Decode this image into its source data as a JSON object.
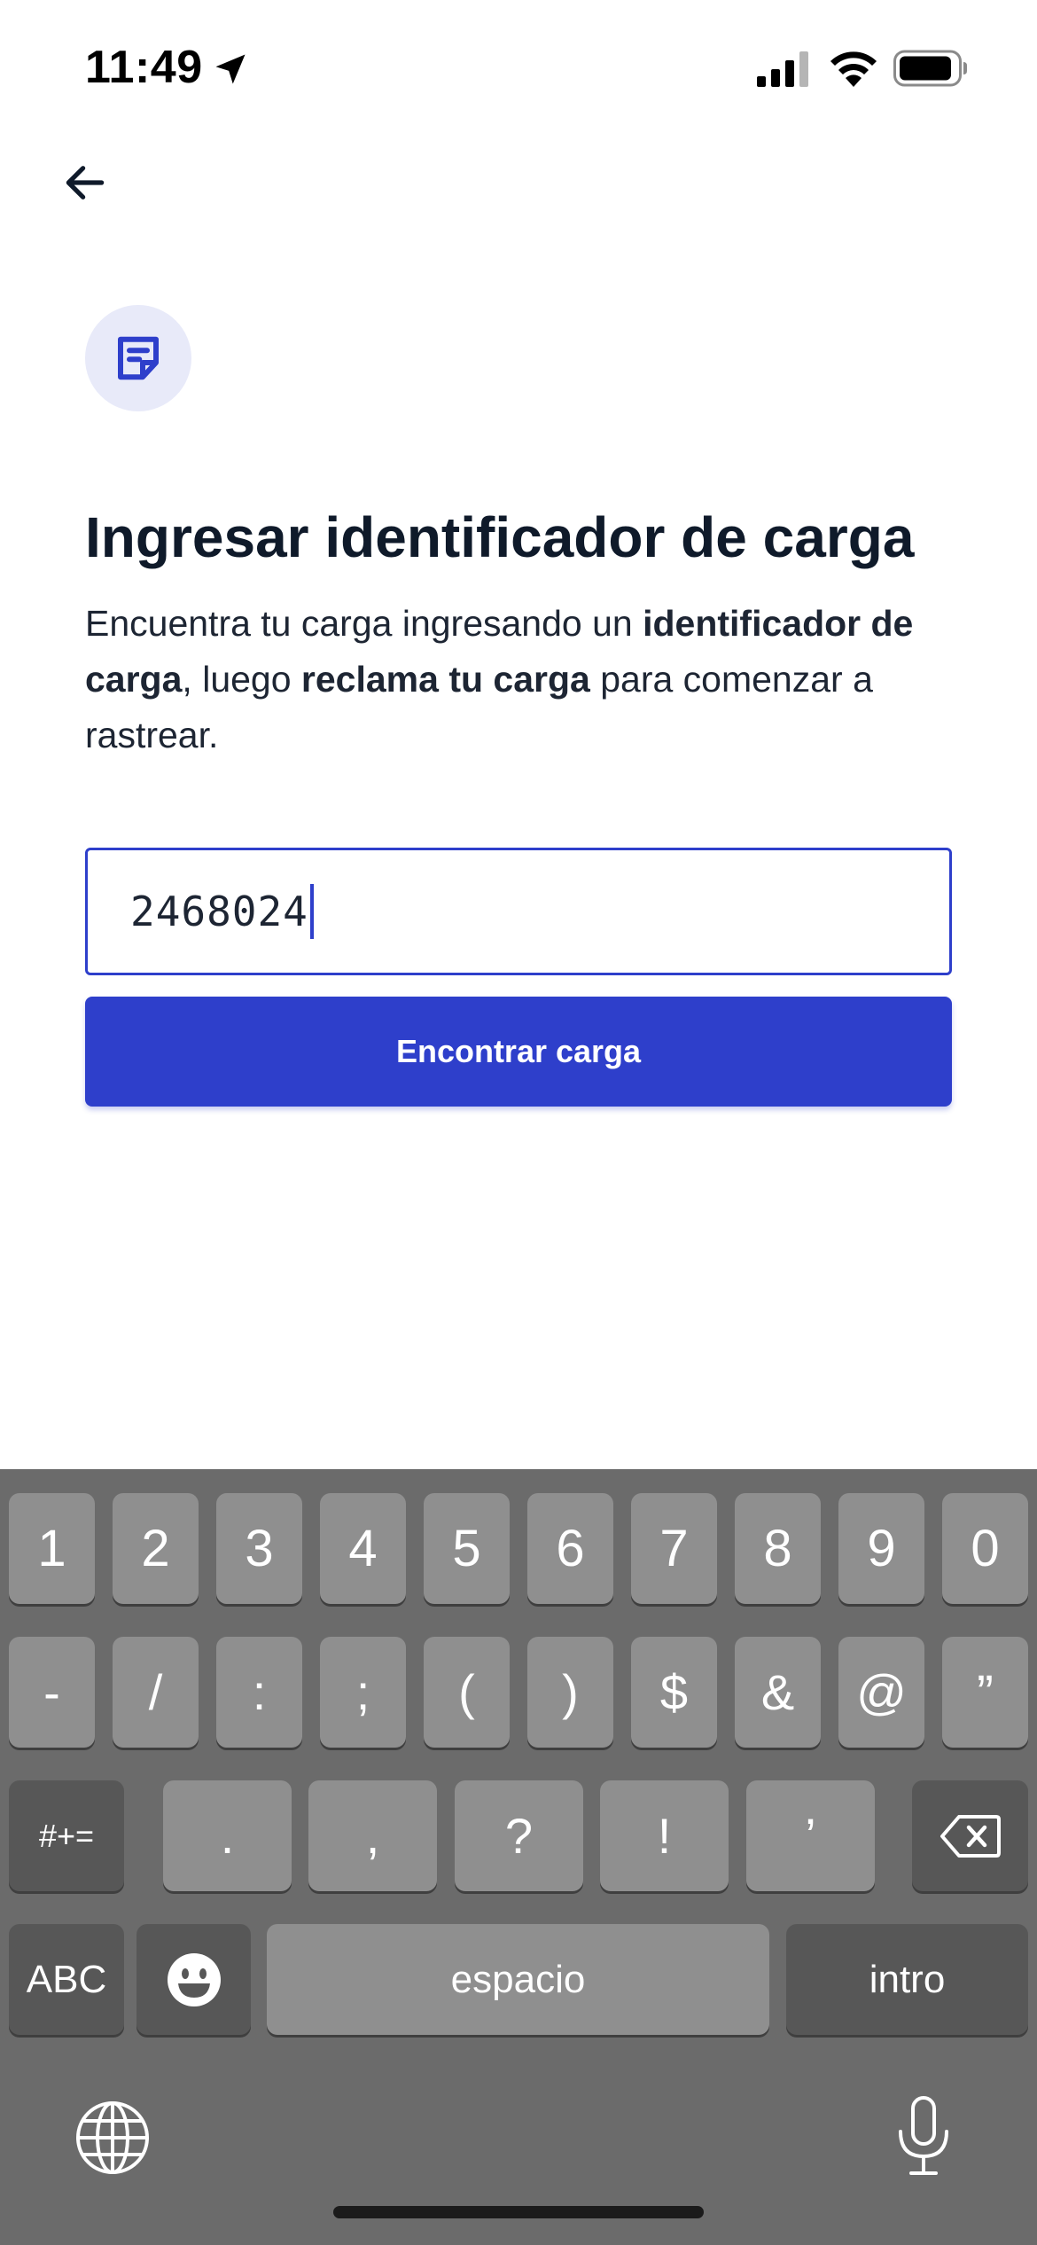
{
  "status_bar": {
    "time": "11:49",
    "icons": [
      "location-arrow-icon",
      "cellular-signal-icon",
      "wifi-icon",
      "battery-icon"
    ]
  },
  "header": {
    "back_icon": "arrow-left-icon",
    "badge_icon": "document-icon"
  },
  "main": {
    "title": "Ingresar identificador de carga",
    "description": {
      "part1": "Encuentra tu carga ingresando un ",
      "bold1": "identificador de carga",
      "part2": ", luego ",
      "bold2": "reclama tu carga",
      "part3": " para comenzar a rastrear."
    },
    "input_value": "2468024",
    "button_label": "Encontrar carga"
  },
  "keyboard": {
    "row1": [
      "1",
      "2",
      "3",
      "4",
      "5",
      "6",
      "7",
      "8",
      "9",
      "0"
    ],
    "row2": [
      "-",
      "/",
      ":",
      ";",
      "(",
      ")",
      "$",
      "&",
      "@",
      "”"
    ],
    "row3": [
      "#+=",
      ".",
      ",",
      "?",
      "!",
      "’"
    ],
    "row4": [
      "ABC",
      "espacio",
      "intro"
    ],
    "special_icons": [
      "delete-icon",
      "emoji-icon",
      "globe-icon",
      "microphone-icon"
    ]
  },
  "colors": {
    "accent": "#2e3fcb",
    "badge_bg": "#e8eaf9",
    "keyboard_bg": "#6b6b6b",
    "key_bg": "#8f8f8f",
    "key_dark_bg": "#575757"
  }
}
